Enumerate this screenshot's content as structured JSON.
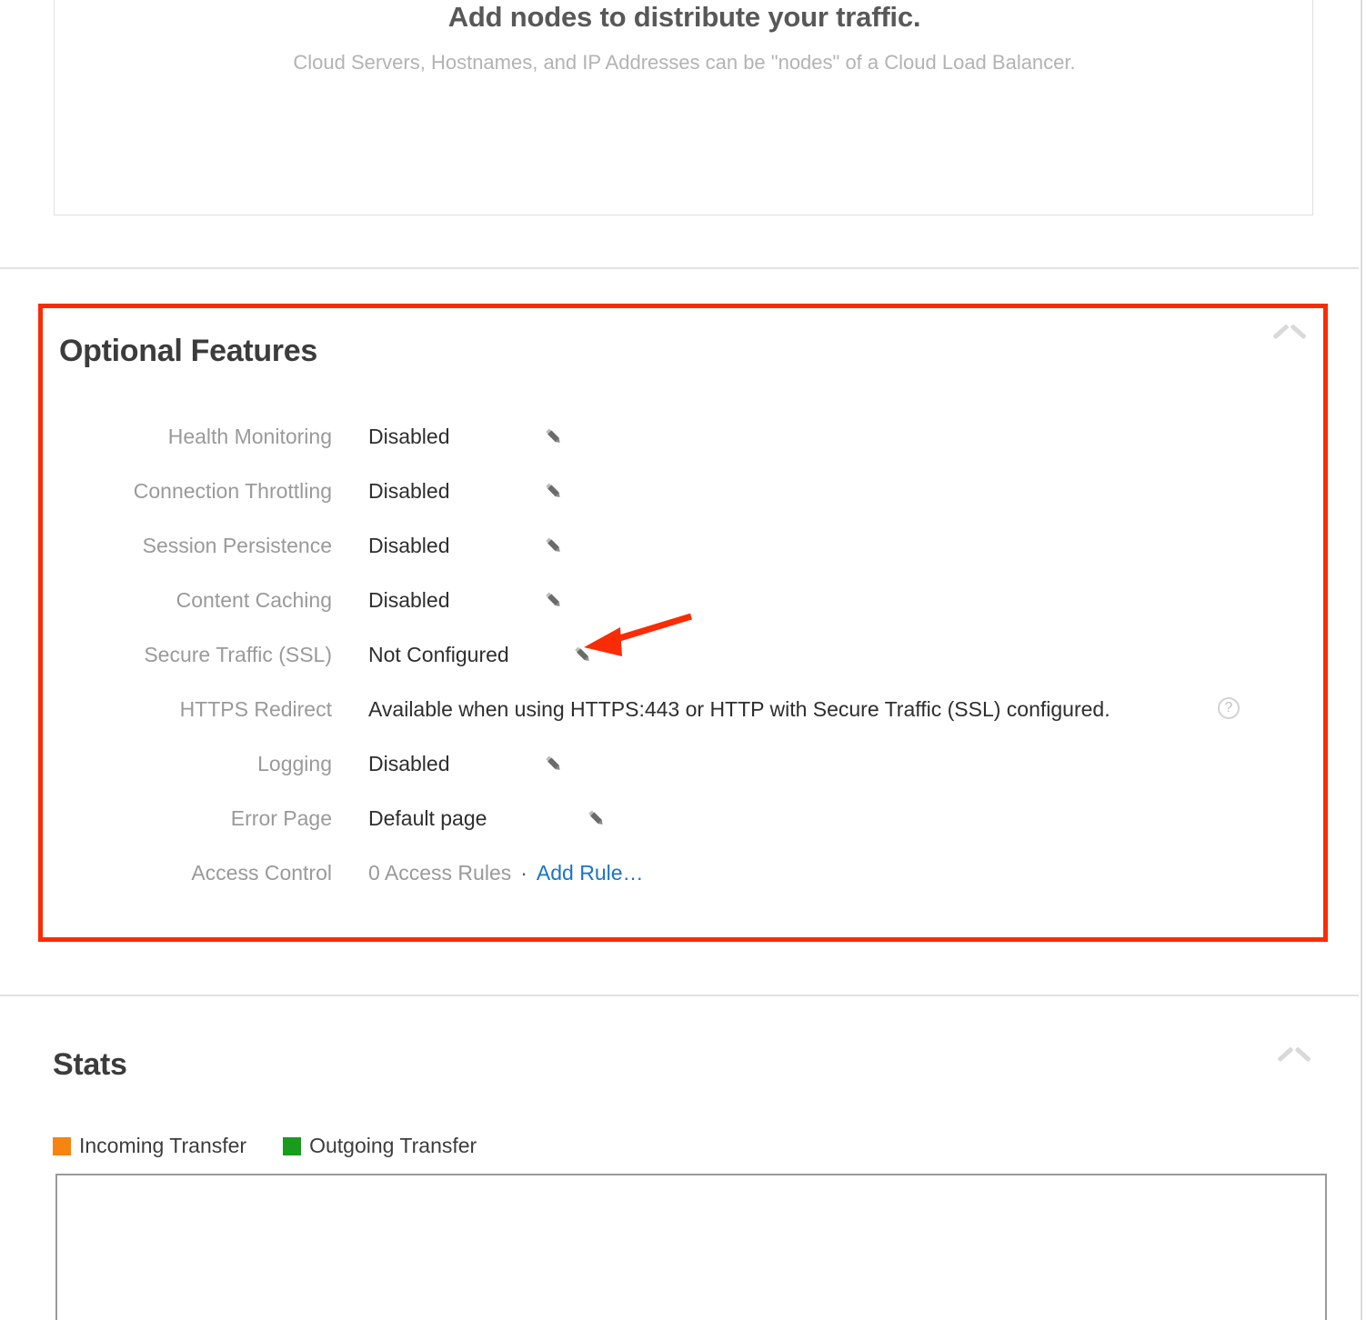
{
  "nodes_panel": {
    "title": "Add nodes to distribute your traffic.",
    "subtitle": "Cloud Servers, Hostnames, and IP Addresses can be \"nodes\" of a Cloud Load Balancer."
  },
  "optional_features": {
    "title": "Optional Features",
    "collapse_icon": "chevron-up-icon",
    "rows": [
      {
        "label": "Health Monitoring",
        "value": "Disabled",
        "edit": true,
        "help": false
      },
      {
        "label": "Connection Throttling",
        "value": "Disabled",
        "edit": true,
        "help": false
      },
      {
        "label": "Session Persistence",
        "value": "Disabled",
        "edit": true,
        "help": false
      },
      {
        "label": "Content Caching",
        "value": "Disabled",
        "edit": true,
        "help": false
      },
      {
        "label": "Secure Traffic (SSL)",
        "value": "Not Configured",
        "edit": true,
        "help": false
      },
      {
        "label": "HTTPS Redirect",
        "value": "Available when using HTTPS:443 or HTTP with Secure Traffic (SSL) configured.",
        "edit": false,
        "help": true
      },
      {
        "label": "Logging",
        "value": "Disabled",
        "edit": true,
        "help": false
      },
      {
        "label": "Error Page",
        "value": "Default page",
        "edit": true,
        "help": false
      }
    ],
    "access_control": {
      "label": "Access Control",
      "rules_text": "0 Access Rules",
      "separator": "·",
      "add_rule_label": "Add Rule…"
    },
    "help_glyph": "?",
    "highlight_color": "#fa2c05"
  },
  "annotation": {
    "arrow_color": "#fa2c05",
    "points_at": "Secure Traffic (SSL) edit pencil"
  },
  "stats": {
    "title": "Stats",
    "collapse_icon": "chevron-up-icon",
    "legend": [
      {
        "label": "Incoming Transfer",
        "color": "#f58410"
      },
      {
        "label": "Outgoing Transfer",
        "color": "#199b1e"
      }
    ]
  }
}
